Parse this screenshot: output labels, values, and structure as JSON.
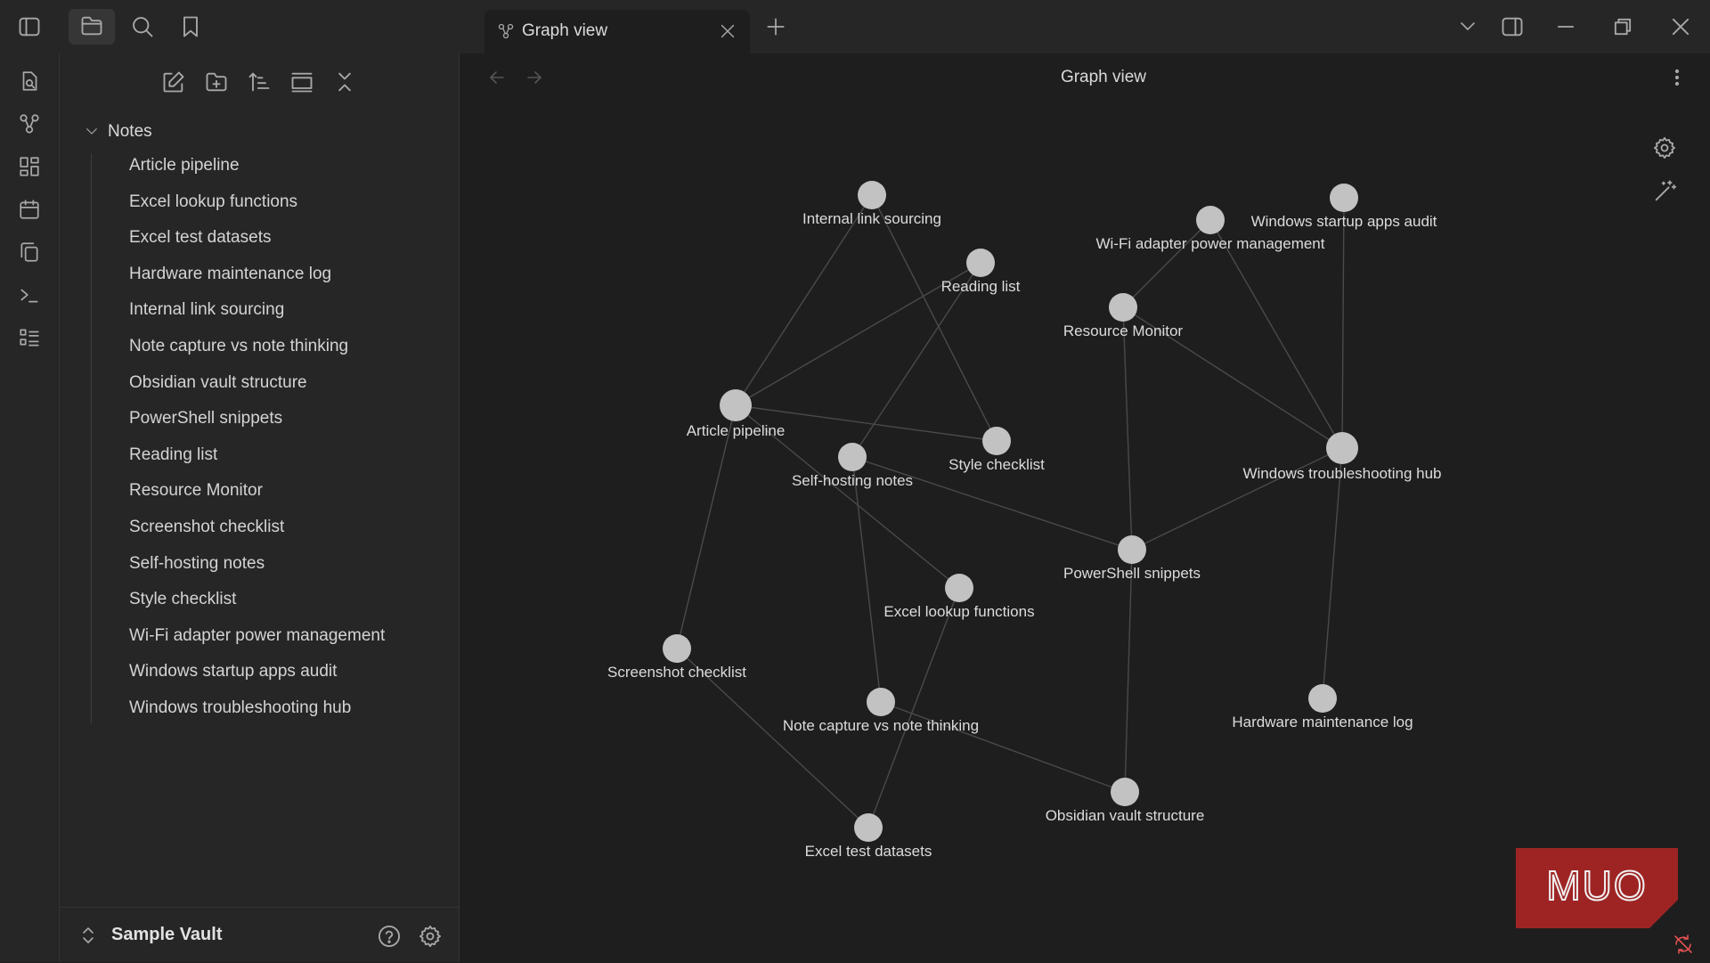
{
  "window": {
    "tab_title": "Graph view",
    "icons": [
      "sidebar-toggle-icon",
      "folder-icon",
      "search-icon",
      "bookmark-icon",
      "graph-icon",
      "close-icon",
      "plus-icon",
      "chevron-down-icon",
      "right-sidebar-icon",
      "minimize-icon",
      "restore-icon",
      "close-window-icon"
    ]
  },
  "ribbon": {
    "icons": [
      "open-quick-switcher-icon",
      "graph-icon",
      "canvas-icon",
      "calendar-icon",
      "templates-icon",
      "terminal-icon",
      "outline-icon"
    ]
  },
  "sidebar": {
    "tools": [
      "new-note-icon",
      "new-folder-icon",
      "sort-icon",
      "auto-reveal-icon",
      "collapse-all-icon"
    ],
    "root_folder": "Notes",
    "files": [
      "Article pipeline",
      "Excel lookup functions",
      "Excel test datasets",
      "Hardware maintenance log",
      "Internal link sourcing",
      "Note capture vs note thinking",
      "Obsidian vault structure",
      "PowerShell snippets",
      "Reading list",
      "Resource Monitor",
      "Screenshot checklist",
      "Self-hosting notes",
      "Style checklist",
      "Wi-Fi adapter power management",
      "Windows startup apps audit",
      "Windows troubleshooting hub"
    ],
    "vault_name": "Sample Vault"
  },
  "main": {
    "view_title": "Graph view"
  },
  "graph": {
    "node_color": "#c2c2c2",
    "edge_color": "#4a4a4a",
    "nodes": [
      {
        "id": "internal",
        "label": "Internal link sourcing",
        "size": "medium"
      },
      {
        "id": "reading",
        "label": "Reading list",
        "size": "medium"
      },
      {
        "id": "wifi",
        "label": "Wi-Fi adapter power management",
        "size": "medium"
      },
      {
        "id": "startup",
        "label": "Windows startup apps audit",
        "size": "medium"
      },
      {
        "id": "resmon",
        "label": "Resource Monitor",
        "size": "medium"
      },
      {
        "id": "article",
        "label": "Article pipeline",
        "size": "large"
      },
      {
        "id": "selfhost",
        "label": "Self-hosting notes",
        "size": "medium"
      },
      {
        "id": "style",
        "label": "Style checklist",
        "size": "medium"
      },
      {
        "id": "hub",
        "label": "Windows troubleshooting hub",
        "size": "large"
      },
      {
        "id": "powershell",
        "label": "PowerShell snippets",
        "size": "medium"
      },
      {
        "id": "excellookup",
        "label": "Excel lookup functions",
        "size": "medium"
      },
      {
        "id": "screenshot",
        "label": "Screenshot checklist",
        "size": "medium"
      },
      {
        "id": "notecapture",
        "label": "Note capture vs note thinking",
        "size": "medium"
      },
      {
        "id": "hardware",
        "label": "Hardware maintenance log",
        "size": "medium"
      },
      {
        "id": "vault",
        "label": "Obsidian vault structure",
        "size": "medium"
      },
      {
        "id": "exceltest",
        "label": "Excel test datasets",
        "size": "medium"
      }
    ],
    "edges": [
      [
        "internal",
        "article"
      ],
      [
        "internal",
        "style"
      ],
      [
        "reading",
        "article"
      ],
      [
        "reading",
        "selfhost"
      ],
      [
        "article",
        "style"
      ],
      [
        "article",
        "screenshot"
      ],
      [
        "article",
        "excellookup"
      ],
      [
        "selfhost",
        "powershell"
      ],
      [
        "selfhost",
        "notecapture"
      ],
      [
        "wifi",
        "resmon"
      ],
      [
        "wifi",
        "hub"
      ],
      [
        "startup",
        "hub"
      ],
      [
        "resmon",
        "hub"
      ],
      [
        "resmon",
        "powershell"
      ],
      [
        "hub",
        "powershell"
      ],
      [
        "hub",
        "hardware"
      ],
      [
        "powershell",
        "vault"
      ],
      [
        "excellookup",
        "exceltest"
      ],
      [
        "notecapture",
        "vault"
      ],
      [
        "screenshot",
        "exceltest"
      ]
    ]
  },
  "watermark": {
    "text": "MUO",
    "color": "#a52a2a"
  }
}
